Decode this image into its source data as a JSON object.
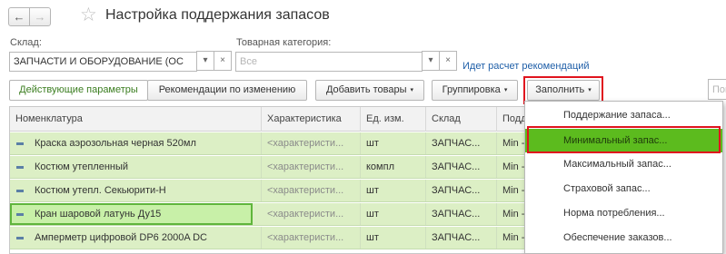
{
  "nav": {
    "back_icon": "←",
    "forward_icon": "→",
    "favorite_icon": "☆"
  },
  "page_title": "Настройка поддержания запасов",
  "filters": {
    "warehouse": {
      "label": "Склад:",
      "value": "ЗАПЧАСТИ И ОБОРУДОВАНИЕ (ОС",
      "dropdown_icon": "▾",
      "clear_icon": "×"
    },
    "category": {
      "label": "Товарная категория:",
      "placeholder": "Все",
      "dropdown_icon": "▾",
      "clear_icon": "×"
    },
    "status_link": "Идет расчет рекомендаций"
  },
  "toolbar": {
    "tab_active": "Действующие параметры",
    "tab_changes": "Рекомендации по изменению",
    "add_goods": "Добавить товары",
    "grouping": "Группировка",
    "fill": "Заполнить",
    "caret": "▾",
    "search_placeholder": "Пои"
  },
  "table": {
    "columns": [
      "Номенклатура",
      "Характеристика",
      "Ед. изм.",
      "Склад",
      "Подде"
    ],
    "rows": [
      {
        "name": "Краска аэрозольная черная 520мл",
        "char": "<характеристи...",
        "unit": "шт",
        "warehouse": "ЗАПЧАС...",
        "support": "Min -"
      },
      {
        "name": "Костюм утепленный",
        "char": "<характеристи...",
        "unit": "компл",
        "warehouse": "ЗАПЧАС...",
        "support": "Min -"
      },
      {
        "name": "Костюм утепл. Секьюрити-Н",
        "char": "<характеристи...",
        "unit": "шт",
        "warehouse": "ЗАПЧАС...",
        "support": "Min -"
      },
      {
        "name": "Кран шаровой латунь Ду15",
        "char": "<характеристи...",
        "unit": "шт",
        "warehouse": "ЗАПЧАС...",
        "support": "Min -"
      },
      {
        "name": "Амперметр цифровой DP6 2000A DC",
        "char": "<характеристи...",
        "unit": "шт",
        "warehouse": "ЗАПЧАС...",
        "support": "Min -"
      }
    ]
  },
  "fill_menu": {
    "items": [
      "Поддержание запаса...",
      "Минимальный запас...",
      "Максимальный запас...",
      "Страховой запас...",
      "Норма потребления...",
      "Обеспечение заказов..."
    ],
    "selected_index": 1
  },
  "colors": {
    "row_bg": "#dcefc5",
    "menu_highlight": "#5cbb1e",
    "callout_border": "#e0141e",
    "link": "#1f5fa8"
  }
}
